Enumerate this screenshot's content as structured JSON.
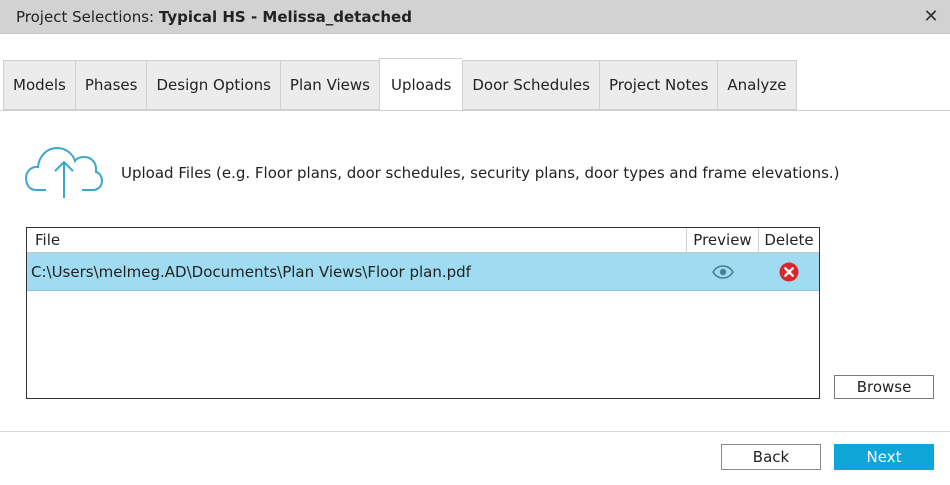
{
  "window": {
    "title_prefix": "Project Selections:",
    "title_project": "Typical HS - Melissa_detached"
  },
  "tabs": [
    {
      "label": "Models"
    },
    {
      "label": "Phases"
    },
    {
      "label": "Design Options"
    },
    {
      "label": "Plan Views"
    },
    {
      "label": "Uploads"
    },
    {
      "label": "Door Schedules"
    },
    {
      "label": "Project Notes"
    },
    {
      "label": "Analyze"
    }
  ],
  "active_tab": "Uploads",
  "upload": {
    "icon": "cloud-upload-icon",
    "instructions": "Upload Files (e.g. Floor plans, door schedules, security plans, door types and frame elevations.)"
  },
  "files_table": {
    "columns": {
      "file": "File",
      "preview": "Preview",
      "delete": "Delete"
    },
    "rows": [
      {
        "file": "C:\\Users\\melmeg.AD\\Documents\\Plan Views\\Floor plan.pdf",
        "preview_icon": "eye-icon",
        "delete_icon": "delete-icon"
      }
    ]
  },
  "buttons": {
    "browse": "Browse",
    "back": "Back",
    "next": "Next"
  },
  "colors": {
    "accent": "#0ea6d6",
    "selected_row": "#9fdcf2",
    "delete": "#e0242c",
    "icon": "#3aa8cc"
  }
}
